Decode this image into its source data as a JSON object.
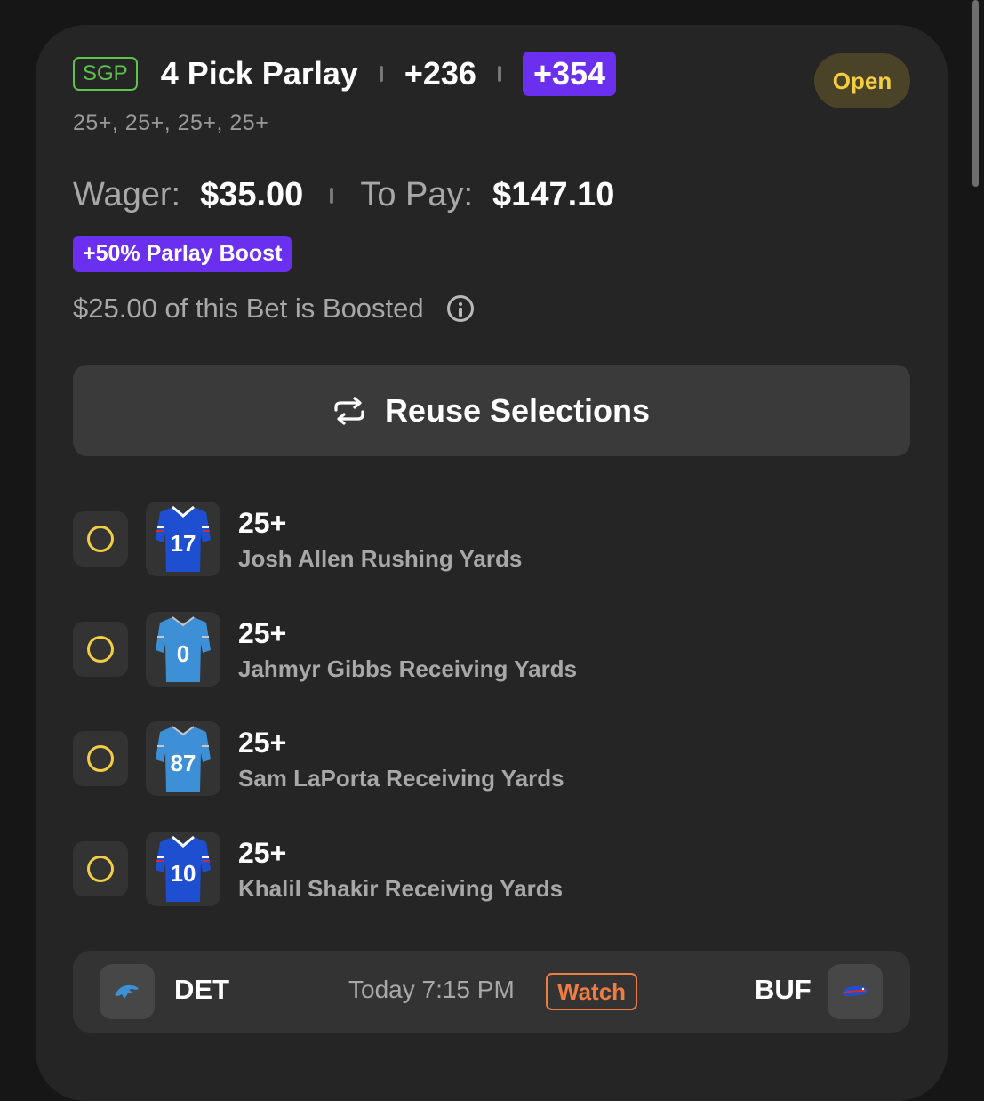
{
  "bet": {
    "tag": "SGP",
    "title": "4 Pick Parlay",
    "original_odds": "+236",
    "boosted_odds": "+354",
    "status": "Open",
    "legs_summary": "25+, 25+, 25+, 25+",
    "wager_label": "Wager:",
    "wager_value": "$35.00",
    "topay_label": "To Pay:",
    "topay_value": "$147.10",
    "boost_badge": "+50% Parlay Boost",
    "boosted_note": "$25.00 of this Bet is Boosted",
    "reuse_label": "Reuse Selections"
  },
  "legs": [
    {
      "line": "25+",
      "market": "Josh Allen Rushing Yards",
      "number": "17",
      "team": "BUF"
    },
    {
      "line": "25+",
      "market": "Jahmyr Gibbs Receiving Yards",
      "number": "0",
      "team": "DET"
    },
    {
      "line": "25+",
      "market": "Sam LaPorta Receiving Yards",
      "number": "87",
      "team": "DET"
    },
    {
      "line": "25+",
      "market": "Khalil Shakir Receiving Yards",
      "number": "10",
      "team": "BUF"
    }
  ],
  "game": {
    "home": "DET",
    "away": "BUF",
    "time": "Today 7:15 PM",
    "watch_label": "Watch"
  },
  "colors": {
    "accent_purple": "#6b2ff0",
    "sgp_green": "#5ec24d",
    "status_yellow": "#f3cd44",
    "watch_orange": "#ee7d45",
    "bills_blue": "#1e4fd0",
    "lions_blue": "#3d8fd6"
  },
  "icons": {
    "info": "info-icon",
    "reuse": "repeat-icon",
    "leg_status": "pending-circle-icon"
  }
}
